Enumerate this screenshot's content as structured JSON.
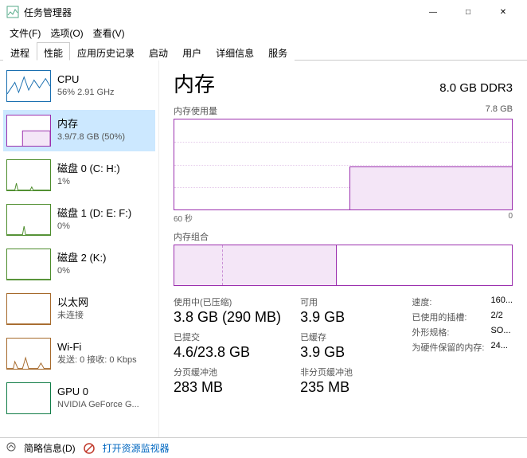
{
  "window": {
    "title": "任务管理器"
  },
  "controls": {
    "min": "—",
    "max": "□",
    "close": "✕"
  },
  "menu": {
    "file": "文件(F)",
    "options": "选项(O)",
    "view": "查看(V)"
  },
  "tabs": {
    "processes": "进程",
    "performance": "性能",
    "apphistory": "应用历史记录",
    "startup": "启动",
    "users": "用户",
    "details": "详细信息",
    "services": "服务"
  },
  "sidebar": [
    {
      "name": "CPU",
      "sub": "56% 2.91 GHz"
    },
    {
      "name": "内存",
      "sub": "3.9/7.8 GB (50%)"
    },
    {
      "name": "磁盘 0 (C: H:)",
      "sub": "1%"
    },
    {
      "name": "磁盘 1 (D: E: F:)",
      "sub": "0%"
    },
    {
      "name": "磁盘 2 (K:)",
      "sub": "0%"
    },
    {
      "name": "以太网",
      "sub": "未连接"
    },
    {
      "name": "Wi-Fi",
      "sub": "发送: 0 接收: 0 Kbps"
    },
    {
      "name": "GPU 0",
      "sub": "NVIDIA GeForce G..."
    }
  ],
  "detail": {
    "title": "内存",
    "capacity": "8.0 GB DDR3",
    "usage_label": "内存使用量",
    "usage_max": "7.8 GB",
    "axis_left": "60 秒",
    "axis_right": "0",
    "composition_label": "内存组合",
    "stats": {
      "in_use_label": "使用中(已压缩)",
      "in_use_value": "3.8 GB (290 MB)",
      "available_label": "可用",
      "available_value": "3.9 GB",
      "committed_label": "已提交",
      "committed_value": "4.6/23.8 GB",
      "cached_label": "已缓存",
      "cached_value": "3.9 GB",
      "paged_label": "分页缓冲池",
      "paged_value": "283 MB",
      "nonpaged_label": "非分页缓冲池",
      "nonpaged_value": "235 MB"
    },
    "info": {
      "speed_label": "速度:",
      "speed_value": "160...",
      "slots_label": "已使用的插槽:",
      "slots_value": "2/2",
      "form_label": "外形规格:",
      "form_value": "SO...",
      "reserved_label": "为硬件保留的内存:",
      "reserved_value": "24..."
    }
  },
  "chart_data": {
    "type": "line",
    "title": "内存使用量",
    "xlabel": "60 秒 → 0",
    "ylabel": "GB",
    "ylim": [
      0,
      7.8
    ],
    "x": [
      60,
      55,
      50,
      45,
      40,
      35,
      32,
      30,
      25,
      20,
      15,
      10,
      5,
      0
    ],
    "values": [
      0,
      0,
      0,
      0,
      0,
      0,
      0,
      3.8,
      3.8,
      3.8,
      3.8,
      3.8,
      3.8,
      3.8
    ]
  },
  "footer": {
    "fewer": "简略信息(D)",
    "resmon": "打开资源监视器"
  }
}
